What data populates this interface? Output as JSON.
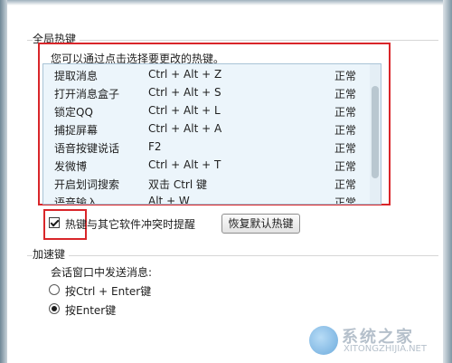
{
  "global_hotkeys": {
    "section_title": "全局热键",
    "hint": "您可以通过点击选择要更改的热键。",
    "rows": [
      {
        "name": "提取消息",
        "keys": "Ctrl + Alt + Z",
        "status": "正常"
      },
      {
        "name": "打开消息盒子",
        "keys": "Ctrl + Alt + S",
        "status": "正常"
      },
      {
        "name": "锁定QQ",
        "keys": "Ctrl + Alt + L",
        "status": "正常"
      },
      {
        "name": "捕捉屏幕",
        "keys": "Ctrl + Alt + A",
        "status": "正常"
      },
      {
        "name": "语音按键说话",
        "keys": "F2",
        "status": "正常"
      },
      {
        "name": "发微博",
        "keys": "Ctrl + Alt + T",
        "status": "正常"
      },
      {
        "name": "开启划词搜索",
        "keys": "双击 Ctrl 键",
        "status": "正常"
      },
      {
        "name": "语音输入",
        "keys": "Alt + W",
        "status": "正常"
      }
    ],
    "conflict_checkbox_label": "热键与其它软件冲突时提醒",
    "conflict_checkbox_checked": true,
    "restore_button_label": "恢复默认热键"
  },
  "accelerator": {
    "section_title": "加速键",
    "subtitle": "会话窗口中发送消息:",
    "options": [
      {
        "label": "按Ctrl + Enter键",
        "checked": false
      },
      {
        "label": "按Enter键",
        "checked": true
      }
    ]
  },
  "watermark": {
    "text_cn": "系统之家",
    "text_en": "XITONGZHIJIA.NET"
  },
  "colors": {
    "highlight_border": "#d9262a",
    "list_background": "#ecf5fb"
  }
}
